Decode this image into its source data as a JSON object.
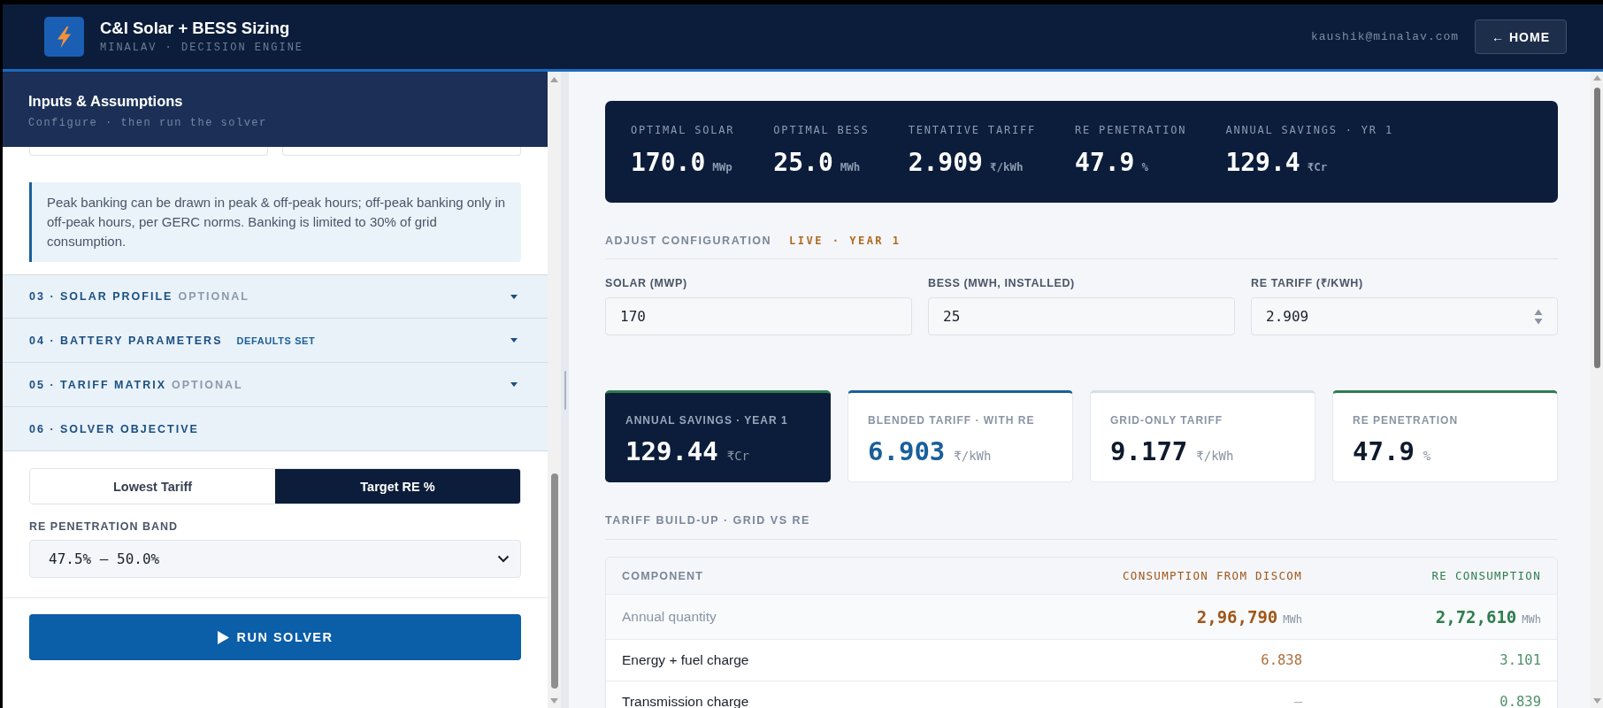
{
  "header": {
    "title": "C&I Solar + BESS Sizing",
    "subtitle": "MINALAV · DECISION ENGINE",
    "user_email": "kaushik@minalav.com",
    "home_button": "← HOME"
  },
  "sidebar": {
    "title": "Inputs & Assumptions",
    "subtitle": "Configure · then run the solver",
    "note": "Peak banking can be drawn in peak & off-peak hours; off-peak banking only in off-peak hours, per GERC norms. Banking is limited to 30% of grid consumption.",
    "sections": [
      {
        "title": "03 · SOLAR PROFILE",
        "tag": {
          "text": "OPTIONAL",
          "kind": "optional"
        },
        "expanded": false
      },
      {
        "title": "04 · BATTERY PARAMETERS",
        "tag": {
          "text": "DEFAULTS SET",
          "kind": "status"
        },
        "expanded": false
      },
      {
        "title": "05 · TARIFF MATRIX",
        "tag": {
          "text": "OPTIONAL",
          "kind": "optional"
        },
        "expanded": false
      },
      {
        "title": "06 · SOLVER OBJECTIVE",
        "expanded": true,
        "objective_options": [
          {
            "label": "Lowest Tariff",
            "selected": false
          },
          {
            "label": "Target RE %",
            "selected": true
          }
        ],
        "band_field": {
          "label": "RE PENETRATION BAND",
          "value": "47.5% – 50.0%"
        }
      }
    ],
    "run_button": "RUN SOLVER"
  },
  "main": {
    "summary": [
      {
        "label": "OPTIMAL SOLAR",
        "value": "170.0",
        "unit": "MWp"
      },
      {
        "label": "OPTIMAL BESS",
        "value": "25.0",
        "unit": "MWh"
      },
      {
        "label": "TENTATIVE TARIFF",
        "value": "2.909",
        "unit": "₹/kWh"
      },
      {
        "label": "RE PENETRATION",
        "value": "47.9",
        "unit": "%"
      },
      {
        "label": "ANNUAL SAVINGS · YR 1",
        "value": "129.4",
        "unit": "₹Cr"
      }
    ],
    "configuration": {
      "title": "ADJUST CONFIGURATION",
      "status": "LIVE · YEAR 1",
      "fields": [
        {
          "label": "SOLAR (MWP)",
          "value": "170",
          "kind": "text"
        },
        {
          "label": "BESS (MWH, INSTALLED)",
          "value": "25",
          "kind": "text"
        },
        {
          "label": "RE TARIFF (₹/KWH)",
          "value": "2.909",
          "kind": "stepper"
        }
      ]
    },
    "metric_cards": [
      {
        "label": "ANNUAL SAVINGS · YEAR 1",
        "value": "129.44",
        "unit": "₹Cr",
        "kind": "dark",
        "color": "#2e7d4f"
      },
      {
        "label": "BLENDED TARIFF · WITH RE",
        "value": "6.903",
        "unit": "₹/kWh",
        "kind": "accent",
        "color": "#1a5f9a"
      },
      {
        "label": "GRID-ONLY TARIFF",
        "value": "9.177",
        "unit": "₹/kWh",
        "kind": "plain",
        "color": "#d9dee6"
      },
      {
        "label": "RE PENETRATION",
        "value": "47.9",
        "unit": "%",
        "kind": "plain",
        "color": "#2e7d4f"
      }
    ],
    "tariff_table": {
      "title": "TARIFF BUILD-UP · GRID VS RE",
      "columns": [
        {
          "label": "COMPONENT",
          "color": "#7a8699"
        },
        {
          "label": "CONSUMPTION FROM DISCOM",
          "color": "#a0561a"
        },
        {
          "label": "RE CONSUMPTION",
          "color": "#2e7d4f"
        }
      ],
      "rows": [
        {
          "kind": "quantity",
          "cells": [
            {
              "value": "Annual quantity",
              "muted": false
            },
            {
              "value": "2,96,790",
              "unit": "MWh",
              "muted": false
            },
            {
              "value": "2,72,610",
              "unit": "MWh",
              "muted": false
            }
          ]
        },
        {
          "kind": "charge",
          "cells": [
            {
              "value": "Energy + fuel charge",
              "muted": false
            },
            {
              "value": "6.838",
              "muted": false
            },
            {
              "value": "3.101",
              "muted": false
            }
          ]
        },
        {
          "kind": "charge",
          "cells": [
            {
              "value": "Transmission charge",
              "muted": false
            },
            {
              "value": "—",
              "muted": true
            },
            {
              "value": "0.839",
              "muted": false
            }
          ]
        }
      ]
    }
  }
}
